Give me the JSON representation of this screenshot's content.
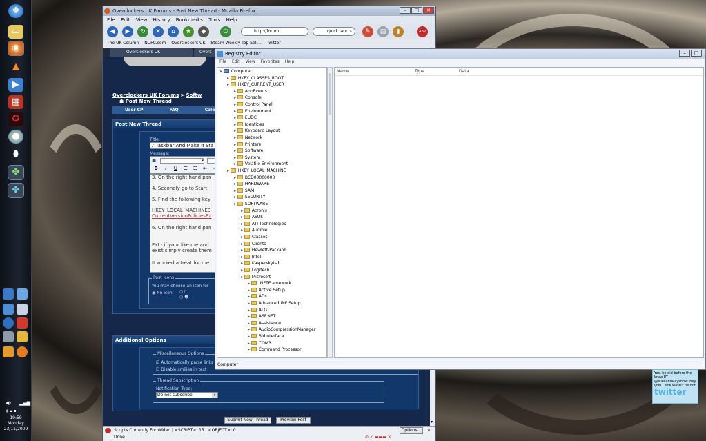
{
  "colors": {
    "forum_bg": "#15284a",
    "forum_panel": "#0e3060",
    "registry_bg": "#eef2f8",
    "taskbar": "#1c2430"
  },
  "taskbar": {
    "clock_time": "19:59",
    "clock_day": "Monday",
    "clock_date": "23/11/2009",
    "icons": [
      "windows-orb-icon",
      "folder-icon",
      "firefox-icon",
      "vlc-icon",
      "media-player-icon",
      "red-app-icon",
      "red-apps-icon",
      "globe-icon",
      "steam-icon",
      "network-icon",
      "network-icon-2"
    ]
  },
  "firefox": {
    "title": "Overclockers UK Forums - Post New Thread - Mozilla Firefox",
    "menu": [
      "File",
      "Edit",
      "View",
      "History",
      "Bookmarks",
      "Tools",
      "Help"
    ],
    "url": "http://forum",
    "search": "quick laur",
    "bookmarks": [
      "The UK Column",
      "NUFC.com",
      "Overclockers UK",
      "Steam Weekly Top Sell...",
      "Twitter"
    ],
    "tabs": [
      "Overclockers UK",
      "Overc"
    ],
    "breadcrumb_root": "Overclockers UK Forums",
    "breadcrumb_sep": ">",
    "breadcrumb_next": "Softw",
    "page_heading": "Post New Thread",
    "navbar": [
      "User CP",
      "FAQ",
      "Calend"
    ],
    "post_panel": "Post New Thread",
    "title_label": "Title:",
    "title_value": "7 Taskbar And Make It Sta",
    "message_label": "Message:",
    "message_lines": [
      "3. On the right hand pan",
      "4. Secondly go to Start",
      "5. Find the following key",
      "HKEY_LOCAL_MACHINES",
      "CurrentVersionPoliciesEx",
      "6. On the right hand pan",
      "FYI - if your like me and",
      "exist simply create them",
      "It worked a treat for me"
    ],
    "post_icons_legend": "Post Icons",
    "post_icons_text": "You may choose an icon for",
    "no_icon": "No icon",
    "additional_options": "Additional Options",
    "misc_legend": "Miscellaneous Options",
    "opt_parse": "Automatically parse links",
    "opt_smilies": "Disable smilies in text",
    "sub_legend": "Thread Subscription",
    "notif_label": "Notification Type:",
    "notif_value": "Do not subscribe",
    "submit": "Submit New Thread",
    "preview": "Preview Post",
    "status_scripts": "Scripts Currently Forbidden | <SCRIPT>: 15 | <OBJECT>: 0",
    "status_options": "Options...",
    "status_done": "Done"
  },
  "registry": {
    "title": "Registry Editor",
    "menu": [
      "File",
      "Edit",
      "View",
      "Favorites",
      "Help"
    ],
    "columns": [
      "Name",
      "Type",
      "Data"
    ],
    "status": "Computer",
    "tree": [
      {
        "label": "Computer",
        "depth": 0
      },
      {
        "label": "HKEY_CLASSES_ROOT",
        "depth": 1
      },
      {
        "label": "HKEY_CURRENT_USER",
        "depth": 1
      },
      {
        "label": "AppEvents",
        "depth": 2
      },
      {
        "label": "Console",
        "depth": 2
      },
      {
        "label": "Control Panel",
        "depth": 2
      },
      {
        "label": "Environment",
        "depth": 2
      },
      {
        "label": "EUDC",
        "depth": 2
      },
      {
        "label": "Identities",
        "depth": 2
      },
      {
        "label": "Keyboard Layout",
        "depth": 2
      },
      {
        "label": "Network",
        "depth": 2
      },
      {
        "label": "Printers",
        "depth": 2
      },
      {
        "label": "Software",
        "depth": 2
      },
      {
        "label": "System",
        "depth": 2
      },
      {
        "label": "Volatile Environment",
        "depth": 2
      },
      {
        "label": "HKEY_LOCAL_MACHINE",
        "depth": 1
      },
      {
        "label": "BCD00000000",
        "depth": 2
      },
      {
        "label": "HARDWARE",
        "depth": 2
      },
      {
        "label": "SAM",
        "depth": 2
      },
      {
        "label": "SECURITY",
        "depth": 2
      },
      {
        "label": "SOFTWARE",
        "depth": 2
      },
      {
        "label": "Acronis",
        "depth": 3
      },
      {
        "label": "ASUS",
        "depth": 3
      },
      {
        "label": "ATI Technologies",
        "depth": 3
      },
      {
        "label": "Audible",
        "depth": 3
      },
      {
        "label": "Classes",
        "depth": 3
      },
      {
        "label": "Clients",
        "depth": 3
      },
      {
        "label": "Hewlett-Packard",
        "depth": 3
      },
      {
        "label": "Intel",
        "depth": 3
      },
      {
        "label": "KasperskyLab",
        "depth": 3
      },
      {
        "label": "Logitech",
        "depth": 3
      },
      {
        "label": "Microsoft",
        "depth": 3
      },
      {
        "label": ".NETFramework",
        "depth": 4
      },
      {
        "label": "Active Setup",
        "depth": 4
      },
      {
        "label": "ADs",
        "depth": 4
      },
      {
        "label": "Advanced INF Setup",
        "depth": 4
      },
      {
        "label": "ALG",
        "depth": 4
      },
      {
        "label": "ASP.NET",
        "depth": 4
      },
      {
        "label": "Assistance",
        "depth": 4
      },
      {
        "label": "AudioCompressionManager",
        "depth": 4
      },
      {
        "label": "BidInterface",
        "depth": 4
      },
      {
        "label": "COM3",
        "depth": 4
      },
      {
        "label": "Command Processor",
        "depth": 4
      }
    ]
  },
  "twitter": {
    "text": "Yes, he did before the knee RT @MikeandRayshow: hey ijoel Crow wasn't he not",
    "logo": "twitter"
  }
}
